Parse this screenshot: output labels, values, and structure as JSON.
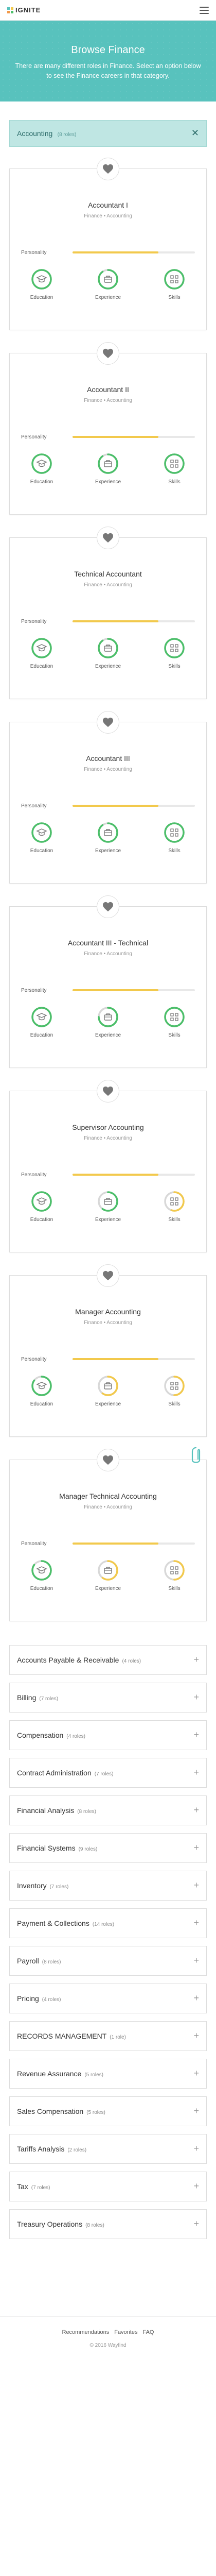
{
  "header": {
    "logo_text": "IGNITE"
  },
  "hero": {
    "title": "Browse Finance",
    "description": "There are many different roles in Finance. Select an option below to see the Finance careers in that category."
  },
  "category": {
    "name": "Accounting",
    "count": "(8 roles)"
  },
  "labels": {
    "personality": "Personality",
    "education": "Education",
    "experience": "Experience",
    "skills": "Skills"
  },
  "colors": {
    "teal": "#58c2bd",
    "green": "#4cbf6a",
    "yellow": "#f2c94c",
    "grey": "#d8d8d8"
  },
  "roles": [
    {
      "title": "Accountant I",
      "subtitle": "Finance • Accounting",
      "personality": 0.7,
      "education": 1.0,
      "experience": 0.9,
      "skills": 1.0,
      "education_color": "green",
      "experience_color": "green",
      "skills_color": "green"
    },
    {
      "title": "Accountant II",
      "subtitle": "Finance • Accounting",
      "personality": 0.7,
      "education": 1.0,
      "experience": 0.9,
      "skills": 1.0,
      "education_color": "green",
      "experience_color": "green",
      "skills_color": "green"
    },
    {
      "title": "Technical Accountant",
      "subtitle": "Finance • Accounting",
      "personality": 0.7,
      "education": 1.0,
      "experience": 0.9,
      "skills": 1.0,
      "education_color": "green",
      "experience_color": "green",
      "skills_color": "green"
    },
    {
      "title": "Accountant III",
      "subtitle": "Finance • Accounting",
      "personality": 0.7,
      "education": 1.0,
      "experience": 0.9,
      "skills": 1.0,
      "education_color": "green",
      "experience_color": "green",
      "skills_color": "green"
    },
    {
      "title": "Accountant III - Technical",
      "subtitle": "Finance • Accounting",
      "personality": 0.7,
      "education": 1.0,
      "experience": 0.75,
      "skills": 1.0,
      "education_color": "green",
      "experience_color": "green",
      "skills_color": "green"
    },
    {
      "title": "Supervisor Accounting",
      "subtitle": "Finance • Accounting",
      "personality": 0.7,
      "education": 1.0,
      "experience": 0.6,
      "skills": 0.55,
      "education_color": "green",
      "experience_color": "green",
      "skills_color": "yellow"
    },
    {
      "title": "Manager Accounting",
      "subtitle": "Finance • Accounting",
      "personality": 0.7,
      "education": 0.85,
      "experience": 0.6,
      "skills": 0.5,
      "education_color": "green",
      "experience_color": "yellow",
      "skills_color": "yellow"
    },
    {
      "title": "Manager Technical Accounting",
      "subtitle": "Finance • Accounting",
      "personality": 0.7,
      "education": 0.85,
      "experience": 0.6,
      "skills": 0.5,
      "education_color": "green",
      "experience_color": "yellow",
      "skills_color": "yellow"
    }
  ],
  "categories": [
    {
      "name": "Accounts Payable & Receivable",
      "count": "(4 roles)"
    },
    {
      "name": "Billing",
      "count": "(7 roles)"
    },
    {
      "name": "Compensation",
      "count": "(4 roles)"
    },
    {
      "name": "Contract Administration",
      "count": "(7 roles)"
    },
    {
      "name": "Financial Analysis",
      "count": "(8 roles)"
    },
    {
      "name": "Financial Systems",
      "count": "(9 roles)"
    },
    {
      "name": "Inventory",
      "count": "(7 roles)"
    },
    {
      "name": "Payment & Collections",
      "count": "(14 roles)"
    },
    {
      "name": "Payroll",
      "count": "(8 roles)"
    },
    {
      "name": "Pricing",
      "count": "(4 roles)"
    },
    {
      "name": "RECORDS MANAGEMENT",
      "count": "(1 role)"
    },
    {
      "name": "Revenue Assurance",
      "count": "(5 roles)"
    },
    {
      "name": "Sales Compensation",
      "count": "(5 roles)"
    },
    {
      "name": "Tariffs Analysis",
      "count": "(2 roles)"
    },
    {
      "name": "Tax",
      "count": "(7 roles)"
    },
    {
      "name": "Treasury Operations",
      "count": "(8 roles)"
    }
  ],
  "footer": {
    "links": [
      "Recommendations",
      "Favorites",
      "FAQ"
    ],
    "copyright": "© 2016 Wayfind"
  }
}
